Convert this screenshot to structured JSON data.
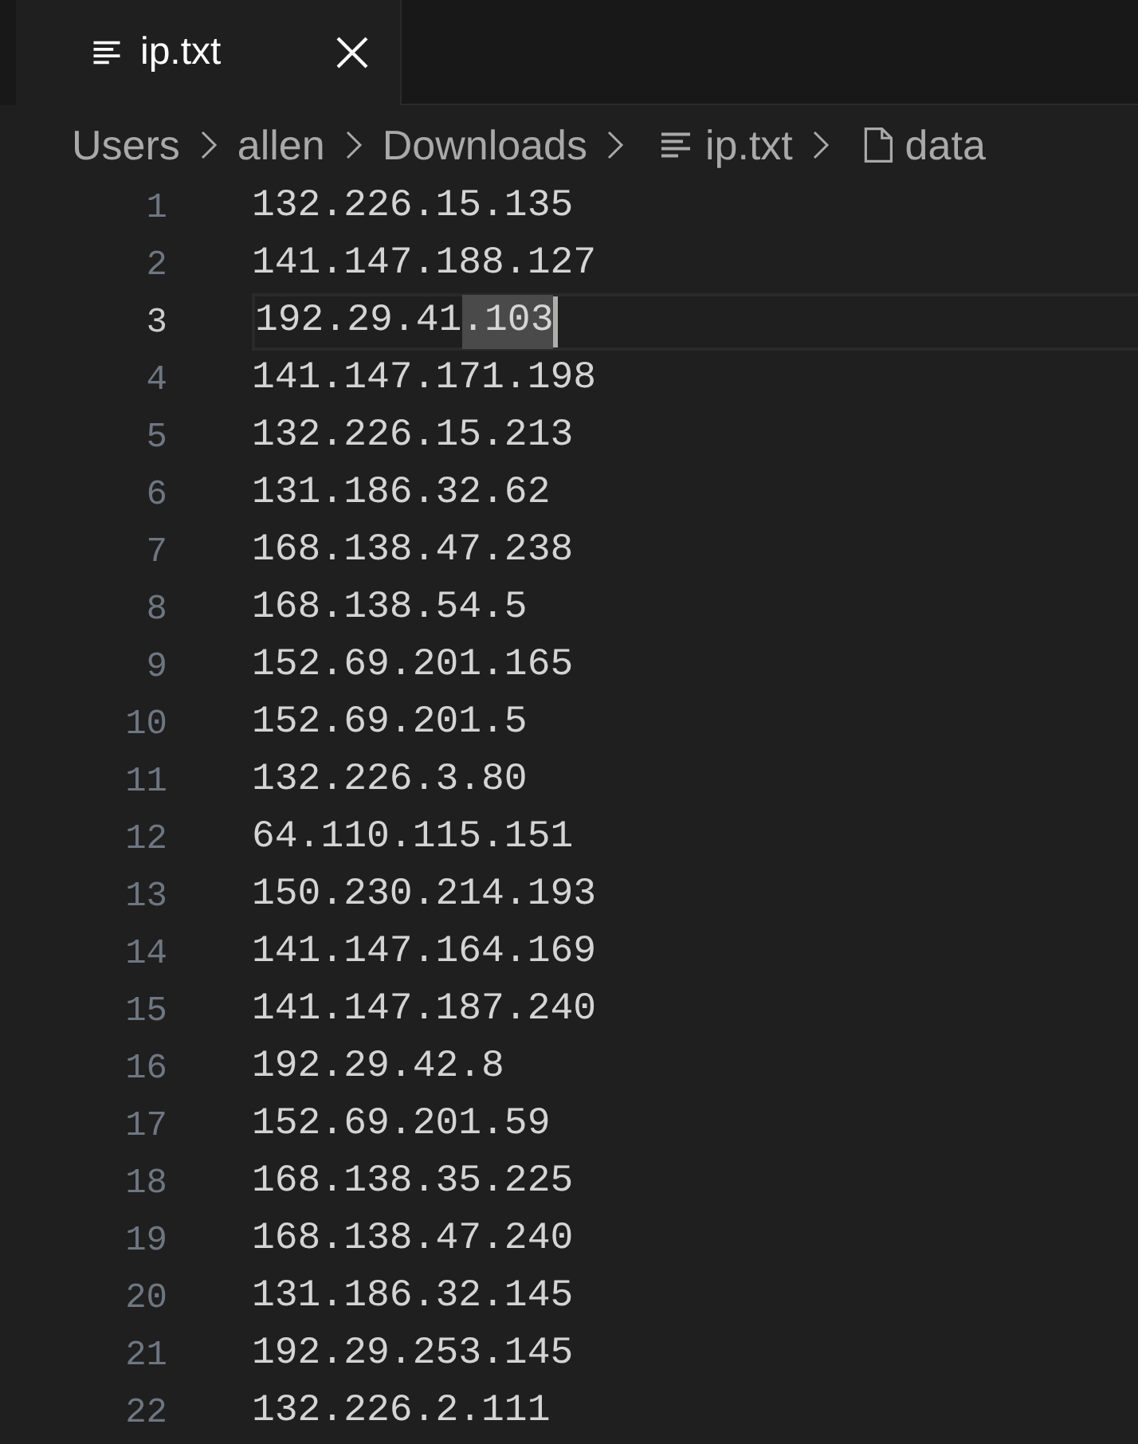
{
  "tabs": [
    {
      "label": "ip.txt",
      "selected": true
    }
  ],
  "breadcrumb": [
    {
      "label": "Users",
      "kind": "folder"
    },
    {
      "label": "allen",
      "kind": "folder"
    },
    {
      "label": "Downloads",
      "kind": "folder"
    },
    {
      "label": "ip.txt",
      "kind": "textfile"
    },
    {
      "label": "data",
      "kind": "symbol"
    }
  ],
  "lines": [
    {
      "number": "1",
      "text": "132.226.15.135",
      "current": false
    },
    {
      "number": "2",
      "text": "141.147.188.127",
      "current": false
    },
    {
      "number": "3",
      "text": "192.29.41",
      "selection": ".103",
      "current": true
    },
    {
      "number": "4",
      "text": "141.147.171.198",
      "current": false
    },
    {
      "number": "5",
      "text": "132.226.15.213",
      "current": false
    },
    {
      "number": "6",
      "text": "131.186.32.62",
      "current": false
    },
    {
      "number": "7",
      "text": "168.138.47.238",
      "current": false
    },
    {
      "number": "8",
      "text": "168.138.54.5",
      "current": false
    },
    {
      "number": "9",
      "text": "152.69.201.165",
      "current": false
    },
    {
      "number": "10",
      "text": "152.69.201.5",
      "current": false
    },
    {
      "number": "11",
      "text": "132.226.3.80",
      "current": false
    },
    {
      "number": "12",
      "text": "64.110.115.151",
      "current": false
    },
    {
      "number": "13",
      "text": "150.230.214.193",
      "current": false
    },
    {
      "number": "14",
      "text": "141.147.164.169",
      "current": false
    },
    {
      "number": "15",
      "text": "141.147.187.240",
      "current": false
    },
    {
      "number": "16",
      "text": "192.29.42.8",
      "current": false
    },
    {
      "number": "17",
      "text": "152.69.201.59",
      "current": false
    },
    {
      "number": "18",
      "text": "168.138.35.225",
      "current": false
    },
    {
      "number": "19",
      "text": "168.138.47.240",
      "current": false
    },
    {
      "number": "20",
      "text": "131.186.32.145",
      "current": false
    },
    {
      "number": "21",
      "text": "192.29.253.145",
      "current": false
    },
    {
      "number": "22",
      "text": "132.226.2.111",
      "current": false
    }
  ]
}
